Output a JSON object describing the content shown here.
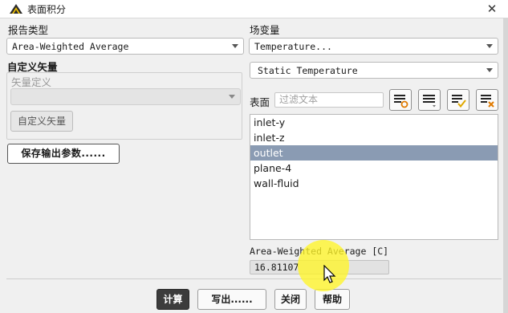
{
  "window": {
    "title": "表面积分",
    "close_glyph": "✕",
    "icon": "app-logo-icon"
  },
  "report_type": {
    "label": "报告类型",
    "value": "Area-Weighted Average"
  },
  "custom_vector": {
    "label": "自定义矢量",
    "definition_label": "矢量定义",
    "definition_value": "",
    "button_label": "自定义矢量"
  },
  "save_output_button": "保存输出参数......",
  "field_variable": {
    "label": "场变量",
    "category": "Temperature...",
    "quantity": "Static Temperature"
  },
  "surfaces": {
    "label": "表面",
    "filter_placeholder": "过滤文本",
    "icons": [
      "select-surfaces-icon",
      "deselect-all-icon",
      "select-all-icon",
      "clear-selection-icon"
    ],
    "items": [
      {
        "name": "inlet-y",
        "selected": false
      },
      {
        "name": "inlet-z",
        "selected": false
      },
      {
        "name": "outlet",
        "selected": true
      },
      {
        "name": "plane-4",
        "selected": false
      },
      {
        "name": "wall-fluid",
        "selected": false
      }
    ]
  },
  "result": {
    "label": "Area-Weighted Average [C]",
    "value": "16.81107"
  },
  "buttons": {
    "compute": "计算",
    "write": "写出......",
    "close": "关闭",
    "help": "帮助"
  },
  "colors": {
    "selection": "#8a9bb3",
    "accent_check": "#e0a800",
    "accent_orange": "#e07a00",
    "highlight": "#fff528"
  }
}
